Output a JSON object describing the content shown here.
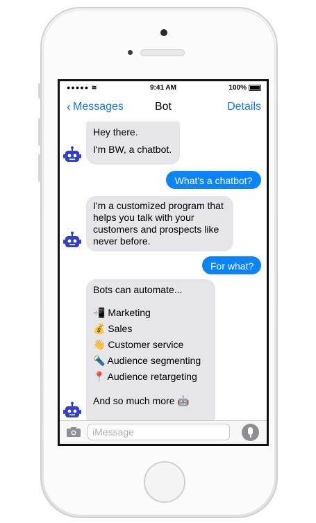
{
  "status_bar": {
    "signal": "●●●●●",
    "time": "9:41 AM",
    "battery": "100%"
  },
  "nav": {
    "back_label": "Messages",
    "title": "Bot",
    "details_label": "Details"
  },
  "messages": [
    {
      "from": "bot",
      "lines": [
        "Hey there.",
        "",
        "I'm BW, a chatbot."
      ]
    },
    {
      "from": "user",
      "lines": [
        "What's a chatbot?"
      ]
    },
    {
      "from": "bot",
      "lines": [
        "I'm a customized program that",
        "helps you talk with your",
        "customers and prospects like",
        "never before."
      ]
    },
    {
      "from": "user",
      "lines": [
        "For what?"
      ]
    },
    {
      "from": "bot",
      "lines": [
        "Bots can automate...",
        "",
        "📲 Marketing",
        "💰 Sales",
        "👋 Customer service",
        "🔦 Audience segmenting",
        "📍 Audience retargeting",
        "",
        "And so much more 🤖"
      ]
    }
  ],
  "input_bar": {
    "placeholder": "iMessage"
  },
  "colors": {
    "accent": "#0a79f7",
    "outgoing_bubble": "#0a84ff",
    "incoming_bubble": "#e5e5ea",
    "bot_avatar": "#2f3fd0"
  },
  "icons": {
    "back": "chevron-left-icon",
    "avatar": "robot-icon",
    "camera": "camera-icon",
    "mic": "microphone-icon"
  }
}
